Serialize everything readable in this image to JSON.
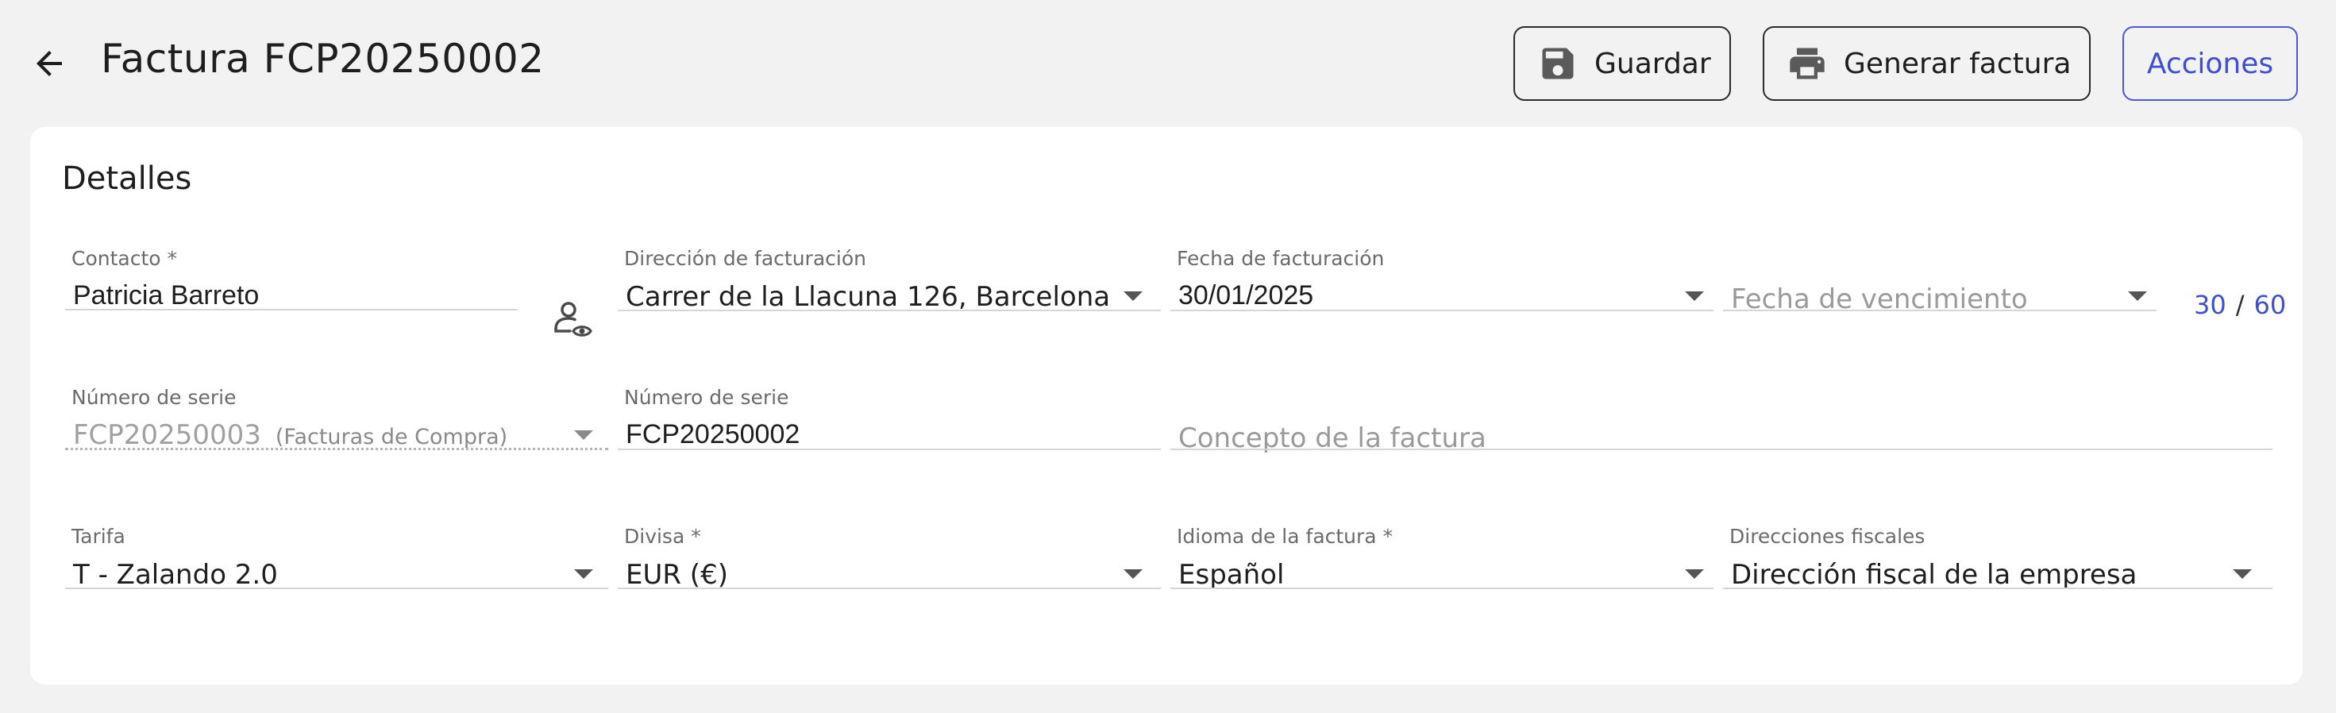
{
  "header": {
    "title": "Factura FCP20250002",
    "save_label": "Guardar",
    "generate_label": "Generar factura",
    "actions_label": "Acciones"
  },
  "details": {
    "title": "Detalles",
    "contact": {
      "label": "Contacto *",
      "value": "Patricia Barreto"
    },
    "billing_address": {
      "label": "Dirección de facturación",
      "value": "Carrer de la Llacuna 126, Barcelona"
    },
    "billing_date": {
      "label": "Fecha de facturación",
      "value": "30/01/2025"
    },
    "due_date": {
      "placeholder": "Fecha de vencimiento",
      "quick_options": [
        "30",
        "60"
      ],
      "separator": "/"
    },
    "series_1": {
      "label": "Número de serie",
      "value": "FCP20250003",
      "suffix": "(Facturas de Compra)"
    },
    "series_2": {
      "label": "Número de serie",
      "value": "FCP20250002"
    },
    "concept": {
      "placeholder": "Concepto de la factura"
    },
    "rate": {
      "label": "Tarifa",
      "value": "T - Zalando 2.0"
    },
    "currency": {
      "label": "Divisa *",
      "value": "EUR (€)"
    },
    "language": {
      "label": "Idioma de la factura *",
      "value": "Español"
    },
    "fiscal_addresses": {
      "label": "Direcciones fiscales",
      "value": "Dirección fiscal de la empresa"
    }
  },
  "colors": {
    "background": "#f2f2f2",
    "card": "#ffffff",
    "accent": "#3f4fd0",
    "text": "#1e1e1e"
  },
  "icons": [
    "back-arrow-icon",
    "save-icon",
    "printer-icon",
    "contact-view-icon",
    "chevron-down-icon"
  ]
}
